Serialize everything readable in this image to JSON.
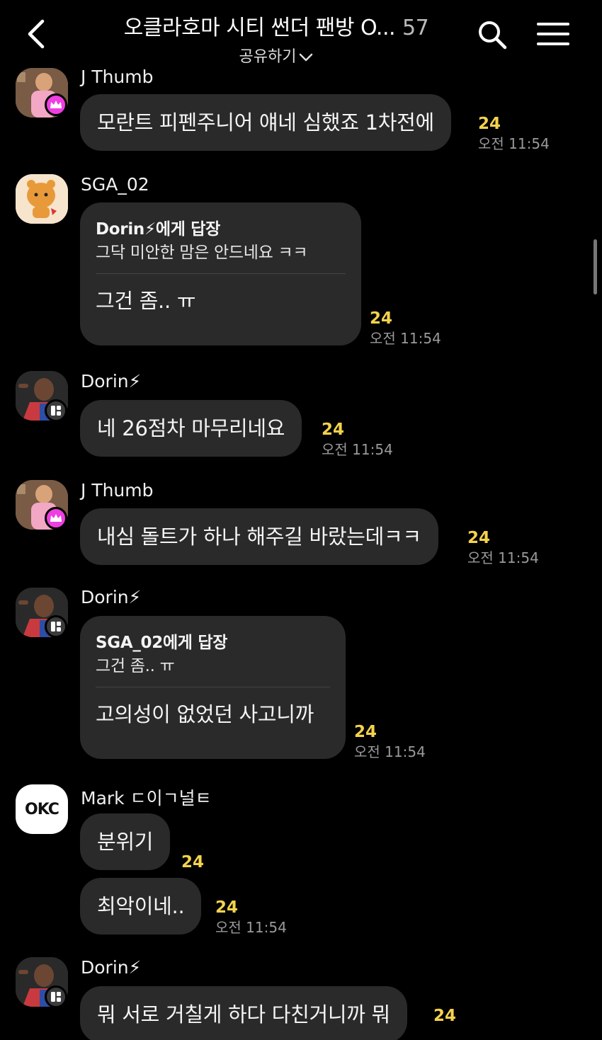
{
  "header": {
    "title": "오클라호마 시티 썬더 팬방 O...",
    "member_count": "57",
    "share_label": "공유하기"
  },
  "messages": [
    {
      "sender": "J Thumb",
      "text": "모란트 피펜주니어 얘네 심했죠 1차전에",
      "unread": "24",
      "time": "오전 11:54"
    },
    {
      "sender": "SGA_02",
      "reply_to": "Dorin⚡에게 답장",
      "quoted": "그닥 미안한 맘은 안드네요 ㅋㅋ",
      "text": "그건 좀.. ㅠ",
      "unread": "24",
      "time": "오전 11:54"
    },
    {
      "sender": "Dorin⚡",
      "text": "네 26점차 마무리네요",
      "unread": "24",
      "time": "오전 11:54"
    },
    {
      "sender": "J Thumb",
      "text": "내심 돌트가 하나 해주길 바랐는데ㅋㅋ",
      "unread": "24",
      "time": "오전 11:54"
    },
    {
      "sender": "Dorin⚡",
      "reply_to": "SGA_02에게 답장",
      "quoted": "그건 좀.. ㅠ",
      "text": "고의성이 없었던 사고니까",
      "unread": "24",
      "time": "오전 11:54"
    },
    {
      "sender": "Mark ㄷ이ㄱ널ㅌ",
      "avatar_text": "OKC",
      "text": "분위기",
      "unread": "24"
    },
    {
      "text": "최악이네..",
      "unread": "24",
      "time": "오전 11:54"
    },
    {
      "sender": "Dorin⚡",
      "text": "뭐 서로 거칠게 하다 다친거니까 뭐",
      "unread": "24"
    }
  ],
  "icons": [
    "back-icon",
    "search-icon",
    "menu-icon",
    "chevron-down-icon",
    "crown-icon",
    "host-icon"
  ],
  "colors": {
    "background": "#000000",
    "bubble": "#2a2a2a",
    "unread": "#f4d24d",
    "time": "#9a9a9a",
    "crown_badge": "#ee3fe1"
  }
}
